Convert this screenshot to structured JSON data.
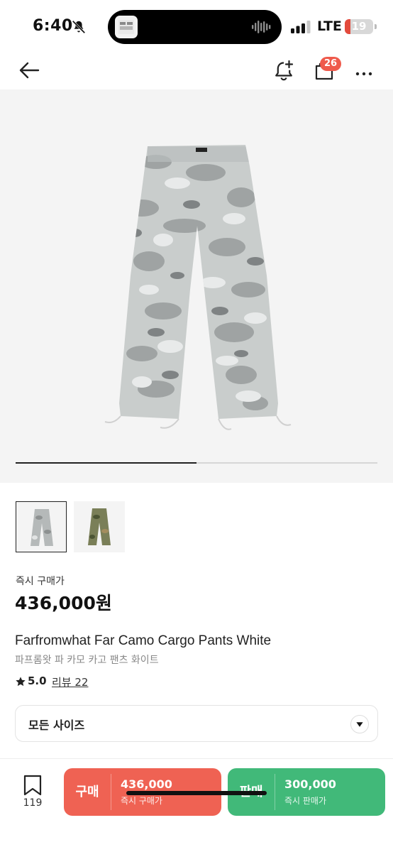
{
  "status_bar": {
    "time": "6:40",
    "network": "LTE",
    "battery_level": "19",
    "battery_fraction": 0.19,
    "icons": [
      "bell-mute-icon",
      "audio-wave-icon",
      "signal-icon",
      "battery-icon"
    ]
  },
  "header": {
    "icons": [
      "back-arrow-icon",
      "bell-plus-icon",
      "cart-icon",
      "more-icon"
    ],
    "cart_count": "26"
  },
  "gallery": {
    "image_count": 2,
    "current_index": 1,
    "progress_fraction": 0.5,
    "images": [
      "grey-camo-cargo-pants",
      "green-camo-cargo-pants"
    ]
  },
  "pricing": {
    "label": "즉시 구매가",
    "value": "436,000원"
  },
  "product": {
    "title_en": "Farfromwhat Far Camo Cargo Pants White",
    "title_ko": "파프롬왓 파 카모 카고 팬츠 화이트",
    "rating": "5.0",
    "reviews_label": "리뷰 22"
  },
  "size_selector": {
    "label": "모든 사이즈",
    "icon": "chevron-down-icon"
  },
  "bottom_bar": {
    "bookmark_count": "119",
    "buy": {
      "label": "구매",
      "price": "436,000",
      "sub": "즉시 구매가",
      "color": "#ef6253"
    },
    "sell": {
      "label": "판매",
      "price": "300,000",
      "sub": "즉시 판매가",
      "color": "#41b979"
    }
  },
  "colors": {
    "accent_red": "#ef5a4c",
    "accent_green": "#41b979"
  }
}
